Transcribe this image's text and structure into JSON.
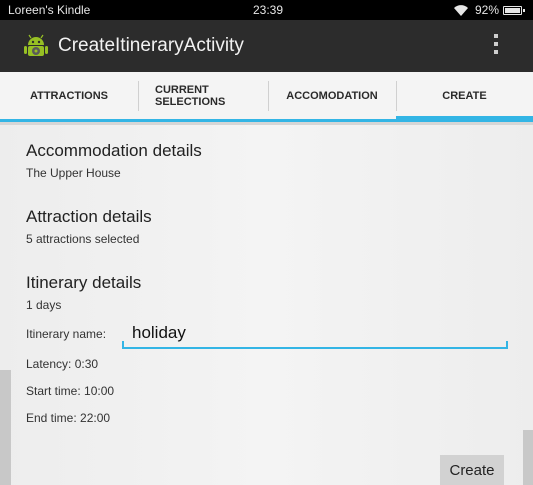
{
  "status_bar": {
    "carrier": "Loreen's Kindle",
    "time": "23:39",
    "battery": "92%",
    "icons": [
      "wifi-icon",
      "battery-icon"
    ]
  },
  "action_bar": {
    "title": "CreateItineraryActivity",
    "icons": [
      "android-app-icon",
      "overflow-menu-icon"
    ]
  },
  "tabs": [
    {
      "label": "ATTRACTIONS",
      "selected": false
    },
    {
      "label": "CURRENT SELECTIONS",
      "selected": false
    },
    {
      "label": "ACCOMODATION",
      "selected": false
    },
    {
      "label": "CREATE",
      "selected": true
    }
  ],
  "accent_color": "#33b5e5",
  "sections": {
    "accommodation": {
      "title": "Accommodation details",
      "value": "The Upper House"
    },
    "attraction": {
      "title": "Attraction details",
      "value": "5 attractions selected"
    },
    "itinerary": {
      "title": "Itinerary details",
      "days": "1 days",
      "name_label": "Itinerary name:",
      "name_value": "holiday",
      "latency": "Latency: 0:30",
      "start_time": "Start time: 10:00",
      "end_time": "End time: 22:00"
    }
  },
  "create_button": "Create"
}
